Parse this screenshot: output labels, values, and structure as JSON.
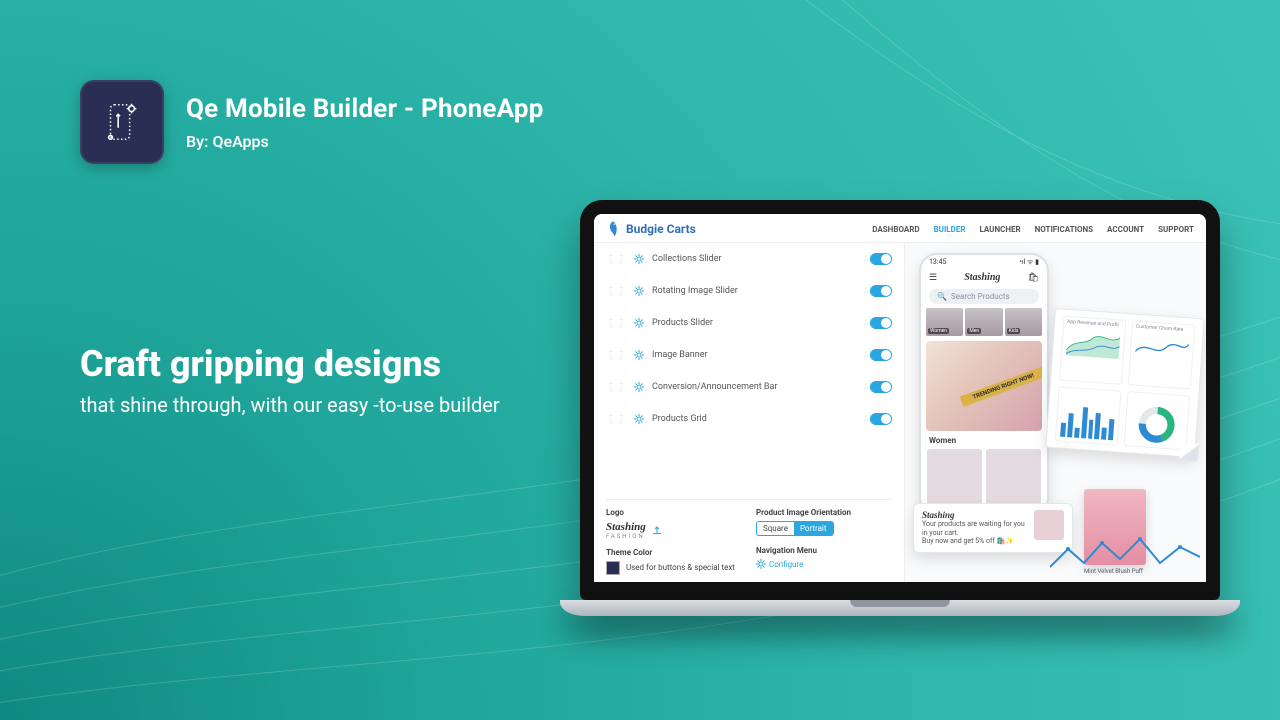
{
  "header": {
    "title": "Qe Mobile Builder - PhoneApp",
    "byline": "By: QeApps"
  },
  "hero": {
    "headline": "Craft gripping designs",
    "sub": "that shine through, with our easy -to-use builder"
  },
  "screen": {
    "brand": "Budgie Carts",
    "nav": [
      "DASHBOARD",
      "BUILDER",
      "LAUNCHER",
      "NOTIFICATIONS",
      "ACCOUNT",
      "SUPPORT"
    ],
    "nav_active": "BUILDER",
    "builder_rows": [
      {
        "label": "Collections Slider",
        "on": true
      },
      {
        "label": "Rotating Image Slider",
        "on": true
      },
      {
        "label": "Products Slider",
        "on": true
      },
      {
        "label": "Image Banner",
        "on": true
      },
      {
        "label": "Conversion/Announcement Bar",
        "on": true
      },
      {
        "label": "Products Grid",
        "on": true
      }
    ],
    "panels": {
      "logo_label": "Logo",
      "logo_name": "Stashing",
      "logo_sub": "FASHION",
      "theme_label": "Theme Color",
      "theme_note": "Used for buttons & special text",
      "theme_color": "#2a2e54",
      "orient_label": "Product Image Orientation",
      "orient_options": [
        "Square",
        "Portrait"
      ],
      "orient_selected": "Portrait",
      "navmenu_label": "Navigation Menu",
      "configure": "Configure"
    },
    "phone": {
      "time": "13:45",
      "brand": "Stashing",
      "search_placeholder": "Search Products",
      "categories": [
        "Women",
        "Men",
        "Kids"
      ],
      "ribbon": "TRENDING RIGHT NOW!",
      "section": "Women"
    },
    "notif": {
      "brand": "Stashing",
      "line1": "Your products are waiting for you in your cart.",
      "line2": "Buy now and get 5% off 🛍️✨"
    },
    "product": {
      "name": "Mint Velvet Blush Puff"
    },
    "paper_titles": [
      "App Revenue and Profit",
      "Customer Churn Rate",
      "",
      "",
      ""
    ]
  }
}
